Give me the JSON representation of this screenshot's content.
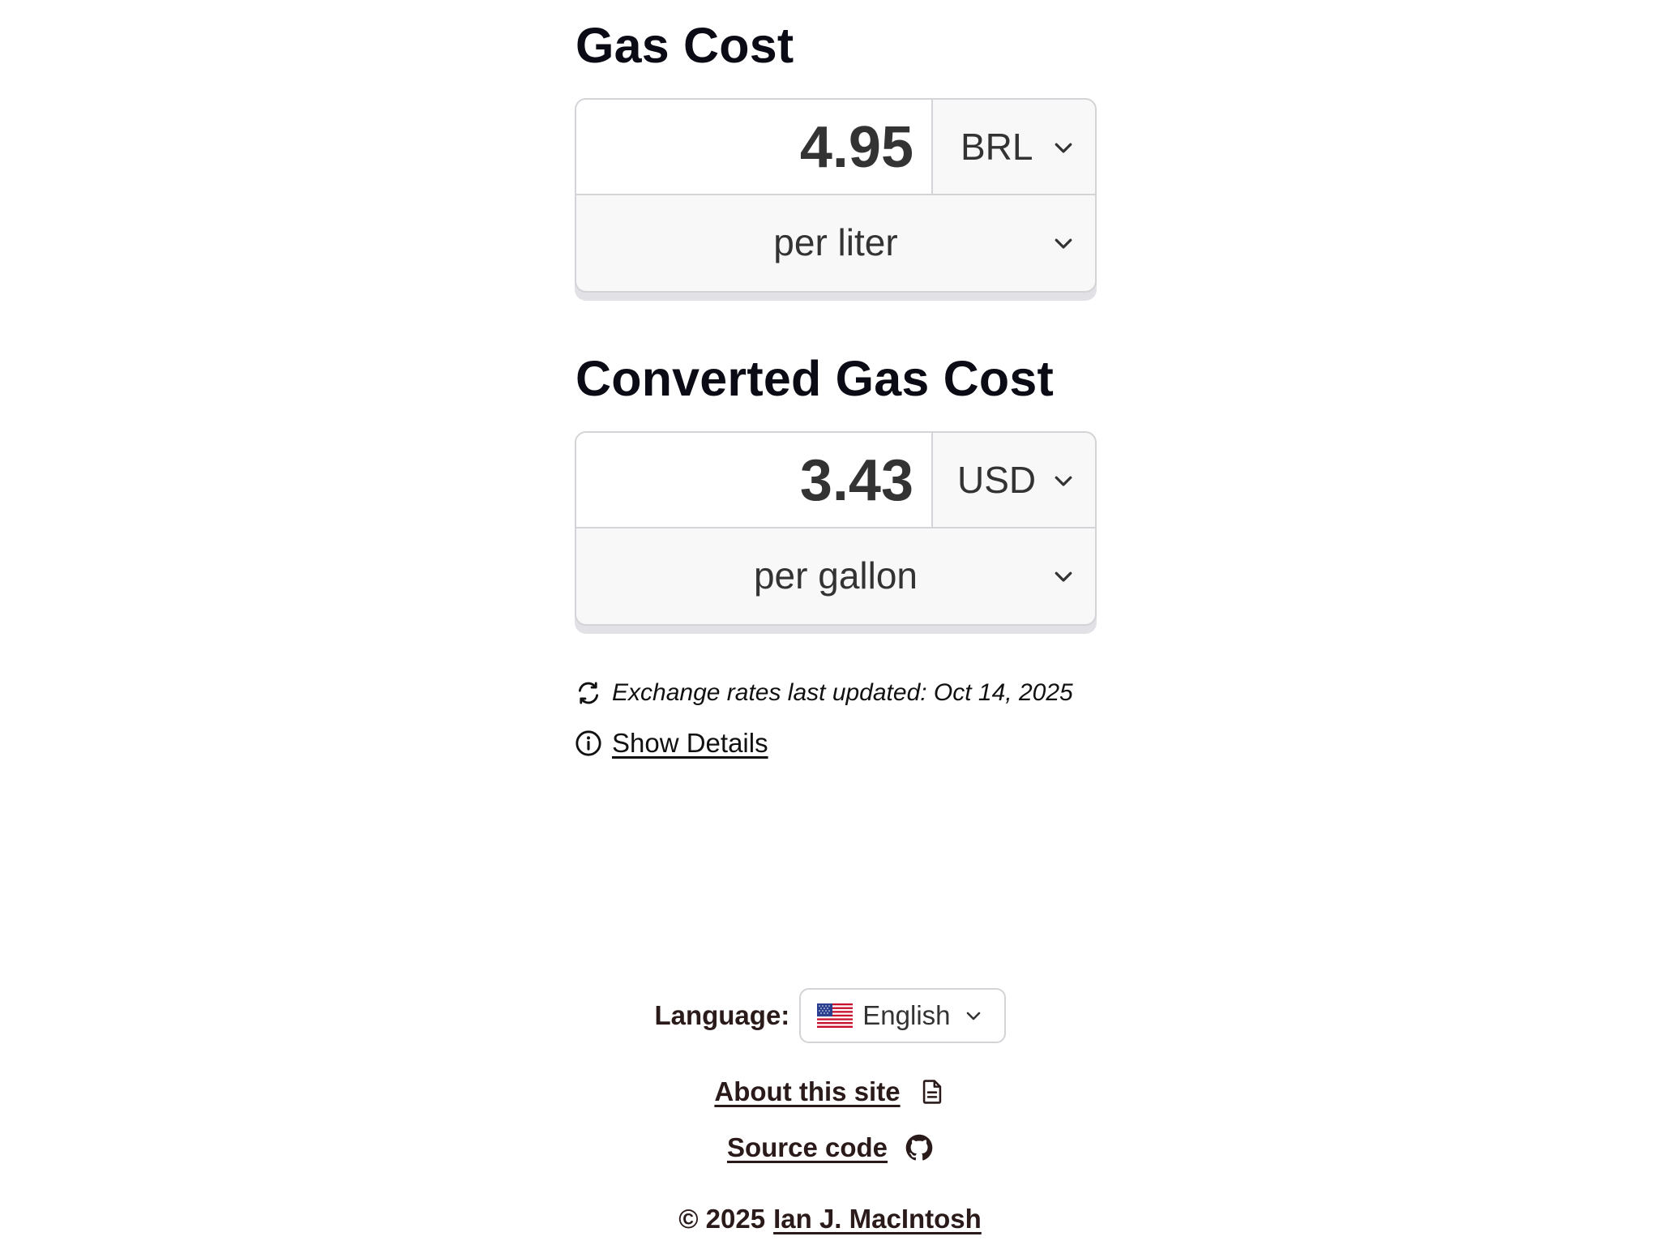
{
  "gas_cost": {
    "title": "Gas Cost",
    "amount": "4.95",
    "currency": "BRL",
    "unit": "per liter"
  },
  "converted": {
    "title": "Converted Gas Cost",
    "amount": "3.43",
    "currency": "USD",
    "unit": "per gallon"
  },
  "info": {
    "updated_text": "Exchange rates last updated: Oct 14, 2025",
    "details_link": "Show Details"
  },
  "footer": {
    "language_label": "Language:",
    "language_value": "English",
    "about_link": "About this site",
    "source_link": "Source code",
    "copyright": "© 2025",
    "author_link": "Ian J. MacIntosh"
  },
  "icons": {
    "refresh": "refresh-icon",
    "info": "info-icon",
    "chevron": "chevron-down-icon",
    "flag": "us-flag-icon",
    "document": "document-icon",
    "github": "github-icon"
  }
}
